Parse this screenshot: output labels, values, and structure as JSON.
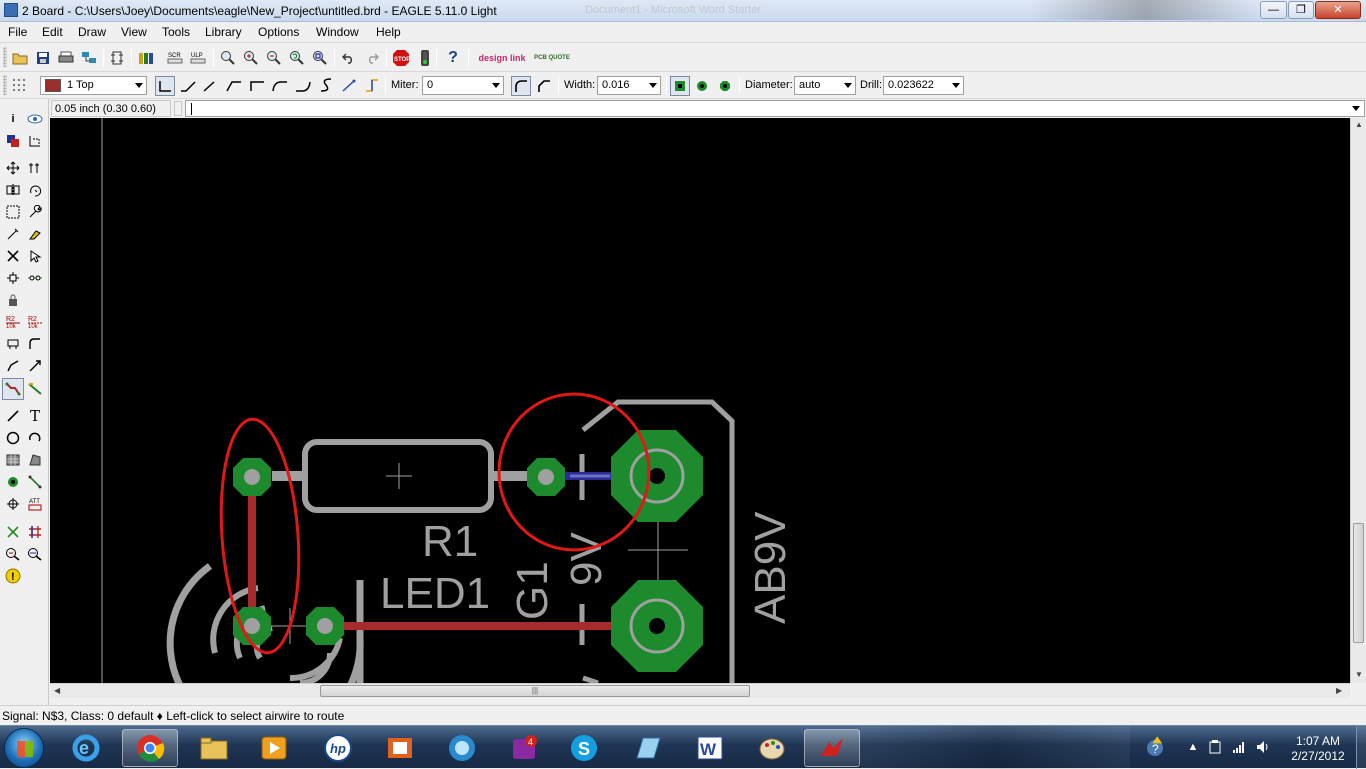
{
  "window": {
    "title": "2 Board - C:\\Users\\Joey\\Documents\\eagle\\New_Project\\untitled.brd - EAGLE 5.11.0 Light",
    "background_window_title": "Document1 - Microsoft Word Starter",
    "min_label": "—",
    "max_label": "❐",
    "close_label": "✕"
  },
  "menu": {
    "items": [
      "File",
      "Edit",
      "Draw",
      "View",
      "Tools",
      "Library",
      "Options",
      "Window",
      "Help"
    ]
  },
  "toolbar1": {
    "icons": [
      "open-icon",
      "save-icon",
      "print-icon",
      "cam-processor-icon",
      "board-schematic-switch-icon",
      "use-library-icon",
      "script-icon",
      "ulp-icon",
      "zoom-fit-icon",
      "zoom-in-icon",
      "zoom-out-icon",
      "zoom-redraw-icon",
      "zoom-select-icon",
      "undo-icon",
      "redo-icon",
      "stop-icon",
      "go-icon",
      "help-icon",
      "design-link-icon",
      "pcb-quote-icon"
    ],
    "designlink_label": "design link",
    "pcbquote_label": "PCB QUOTE"
  },
  "toolbar2": {
    "layer_value": "1 Top",
    "layer_color": "#9b2d2d",
    "miter_label": "Miter:",
    "miter_value": "0",
    "width_label": "Width:",
    "width_value": "0.016",
    "diameter_label": "Diameter:",
    "diameter_value": "auto",
    "drill_label": "Drill:",
    "drill_value": "0.023622"
  },
  "cmdbar": {
    "coord_text": "0.05 inch (0.30 0.60)",
    "command_value": ""
  },
  "left_tools": [
    "info-icon",
    "show-icon",
    "display-icon",
    "mark-icon",
    "move-icon",
    "copy-icon",
    "mirror-icon",
    "rotate-icon",
    "group-icon",
    "change-icon",
    "paste-icon",
    "delete-icon",
    "add-icon",
    "replace-icon",
    "lock-icon",
    "name-icon",
    "value-icon",
    "smash-icon",
    "miter-icon",
    "split-icon",
    "optimize-icon",
    "route-icon",
    "ripup-icon",
    "wire-icon",
    "text-icon",
    "circle-icon",
    "arc-icon",
    "rect-icon",
    "polygon-icon",
    "via-icon",
    "signal-icon",
    "hole-icon",
    "attribute-icon",
    "ratsnest-icon",
    "auto-icon",
    "erc-icon",
    "drc-icon",
    "errors-icon"
  ],
  "board": {
    "resistor_name": "R1",
    "led_name": "LED1",
    "battery_name": "G1",
    "battery_value": "9V",
    "connector_value": "AB9V",
    "trace_color": "#a82a2a",
    "bottom_trace_color": "#2a2a9a",
    "pad_color": "#1d8a2d",
    "silk_color": "#a0a0a0",
    "annotation_color": "#e01818"
  },
  "status": {
    "text": "Signal: N$3, Class: 0 default  ♦ Left-click to select airwire to route"
  },
  "taskbar": {
    "apps": [
      "internet-explorer-icon",
      "chrome-icon",
      "explorer-icon",
      "media-icon",
      "hp-icon",
      "office-icon",
      "mountain-lion-icon",
      "app-badge-icon",
      "skype-icon",
      "notepad-icon",
      "word-icon",
      "paint-icon",
      "eagle-icon"
    ],
    "time": "1:07 AM",
    "date": "2/27/2012"
  }
}
